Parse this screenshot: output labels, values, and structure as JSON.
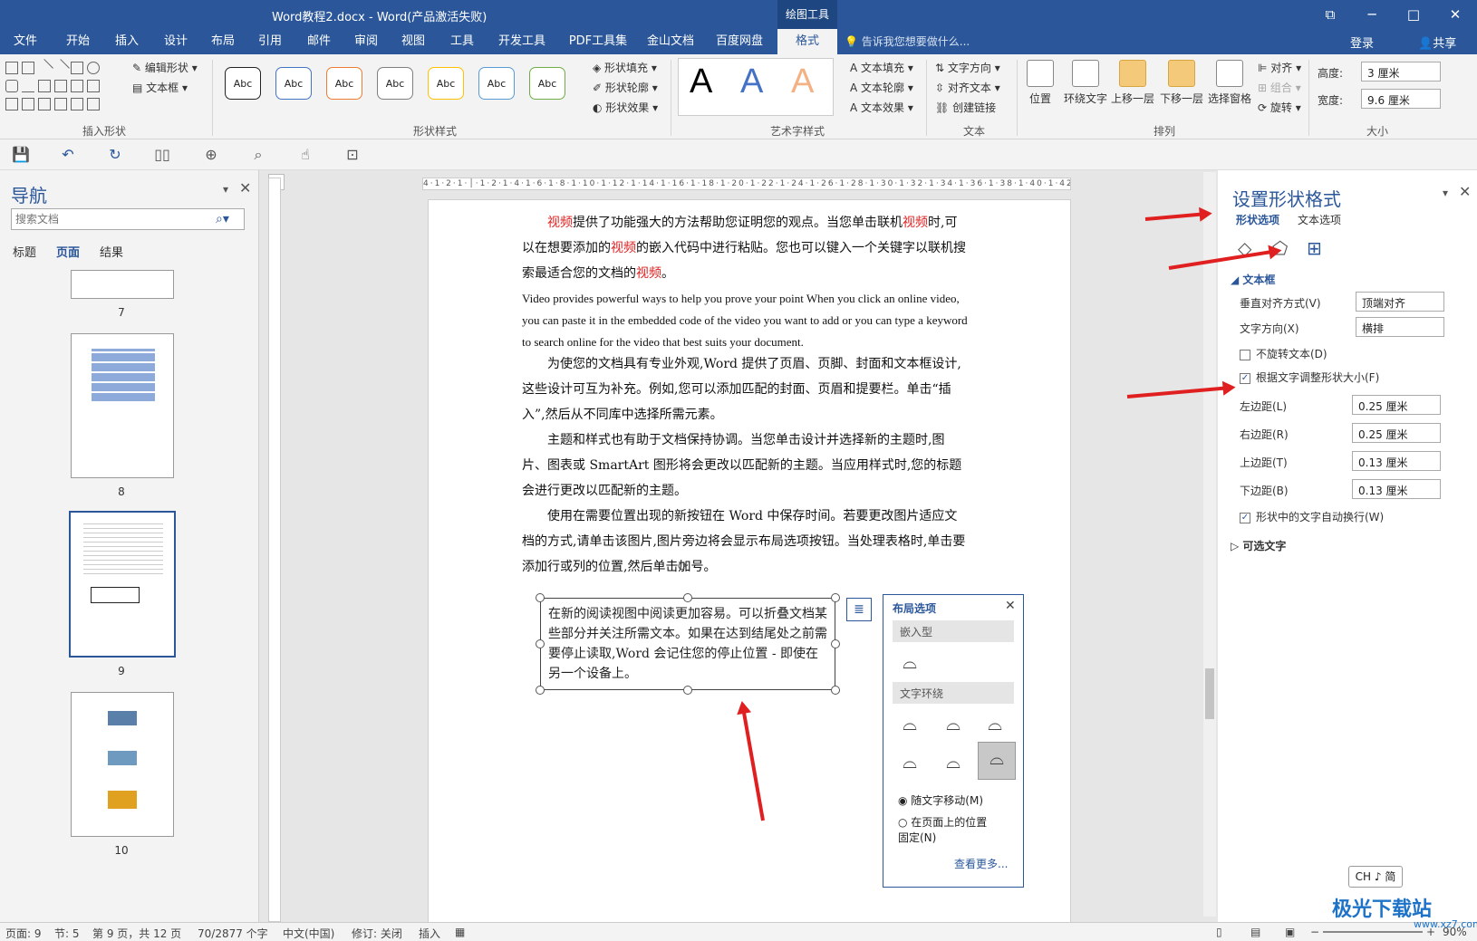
{
  "titlebar": {
    "title": "Word教程2.docx - Word(产品激活失败)",
    "context": "绘图工具",
    "restore": "⧉",
    "min": "─",
    "max": "□",
    "close": "✕"
  },
  "tabs": [
    "文件",
    "开始",
    "插入",
    "设计",
    "布局",
    "引用",
    "邮件",
    "审阅",
    "视图",
    "工具",
    "开发工具",
    "PDF工具集",
    "金山文档",
    "百度网盘",
    "格式"
  ],
  "tell": "告诉我您想要做什么...",
  "login": "登录",
  "share": "共享",
  "ribbon": {
    "insert_shapes": {
      "label": "插入形状",
      "edit_shape": "编辑形状",
      "textbox": "文本框"
    },
    "shape_styles": {
      "label": "形状样式",
      "sample": "Abc",
      "fill": "形状填充",
      "outline": "形状轮廓",
      "effects": "形状效果",
      "colors": [
        "#222222",
        "#4472c4",
        "#ed7d31",
        "#7f7f7f",
        "#ffc000",
        "#5b9bd5",
        "#70ad47"
      ]
    },
    "wordart": {
      "label": "艺术字样式",
      "letter": "A",
      "fill": "文本填充",
      "outline": "文本轮廓",
      "effects": "文本效果"
    },
    "text": {
      "label": "文本",
      "direction": "文字方向",
      "align": "对齐文本",
      "link": "创建链接"
    },
    "arrange": {
      "label": "排列",
      "position": "位置",
      "wrap": "环绕文字",
      "forward": "上移一层",
      "backward": "下移一层",
      "pane": "选择窗格",
      "align": "对齐",
      "group": "组合",
      "rotate": "旋转"
    },
    "size": {
      "label": "大小",
      "height_label": "高度:",
      "height": "3 厘米",
      "width_label": "宽度:",
      "width": "9.6 厘米"
    }
  },
  "nav": {
    "title": "导航",
    "search_placeholder": "搜索文档",
    "tabs": [
      "标题",
      "页面",
      "结果"
    ],
    "pages": [
      "7",
      "8",
      "9",
      "10"
    ]
  },
  "ruler": "4·1·2·1·│·1·2·1·4·1·6·1·8·1·10·1·12·1·14·1·16·1·18·1·20·1·22·1·24·1·26·1·28·1·30·1·32·1·34·1·36·1·38·1·40·1·42·1·44·1·46·1·48",
  "doc": {
    "p1_parts": [
      "视频",
      "提供了功能强大的方法帮助您证明您的观点。当您单击联机",
      "视频",
      "时,可以在想要添加的",
      "视频",
      "的嵌入代码中进行粘贴。您也可以键入一个关键字以联机搜索最适合您的文档的",
      "视频",
      "。"
    ],
    "p2": "Video provides powerful ways to help you prove your point When you click an online video, you can paste it in the embedded code of the video you want to add or you can type a keyword to search online for the video that best suits your document.",
    "p3": "为使您的文档具有专业外观,Word 提供了页眉、页脚、封面和文本框设计,这些设计可互为补充。例如,您可以添加匹配的封面、页眉和提要栏。单击“插入”,然后从不同库中选择所需元素。",
    "p4": "主题和样式也有助于文档保持协调。当您单击设计并选择新的主题时,图片、图表或 SmartArt 图形将会更改以匹配新的主题。当应用样式时,您的标题会进行更改以匹配新的主题。",
    "p5": "使用在需要位置出现的新按钮在 Word 中保存时间。若要更改图片适应文档的方式,请单击该图片,图片旁边将会显示布局选项按钮。当处理表格时,单击要添加行或列的位置,然后单击加号。",
    "textbox": "在新的阅读视图中阅读更加容易。可以折叠文档某些部分并关注所需文本。如果在达到结尾处之前需要停止读取,Word 会记住您的停止位置 - 即使在另一个设备上。"
  },
  "layout": {
    "title": "布局选项",
    "inline": "嵌入型",
    "wrap": "文字环绕",
    "move": "随文字移动(M)",
    "fix": "在页面上的位置固定(N)",
    "more": "查看更多..."
  },
  "pane": {
    "title": "设置形状格式",
    "tab1": "形状选项",
    "tab2": "文本选项",
    "section": "文本框",
    "valign_label": "垂直对齐方式(V)",
    "valign": "顶端对齐",
    "dir_label": "文字方向(X)",
    "dir": "横排",
    "norotate": "不旋转文本(D)",
    "autofit": "根据文字调整形状大小(F)",
    "left_label": "左边距(L)",
    "left": "0.25 厘米",
    "right_label": "右边距(R)",
    "right": "0.25 厘米",
    "top_label": "上边距(T)",
    "top": "0.13 厘米",
    "bottom_label": "下边距(B)",
    "bottom": "0.13 厘米",
    "wrap": "形状中的文字自动换行(W)",
    "alt": "可选文字"
  },
  "status": {
    "page": "页面: 9",
    "section": "节: 5",
    "pages": "第 9 页，共 12 页",
    "words": "70/2877 个字",
    "lang": "中文(中国)",
    "track": "修订: 关闭",
    "insert": "插入",
    "zoom": "90%"
  },
  "ime": "CH ♪ 简",
  "watermark": "极光下载站",
  "watermark_sub": "www.xz7.com"
}
